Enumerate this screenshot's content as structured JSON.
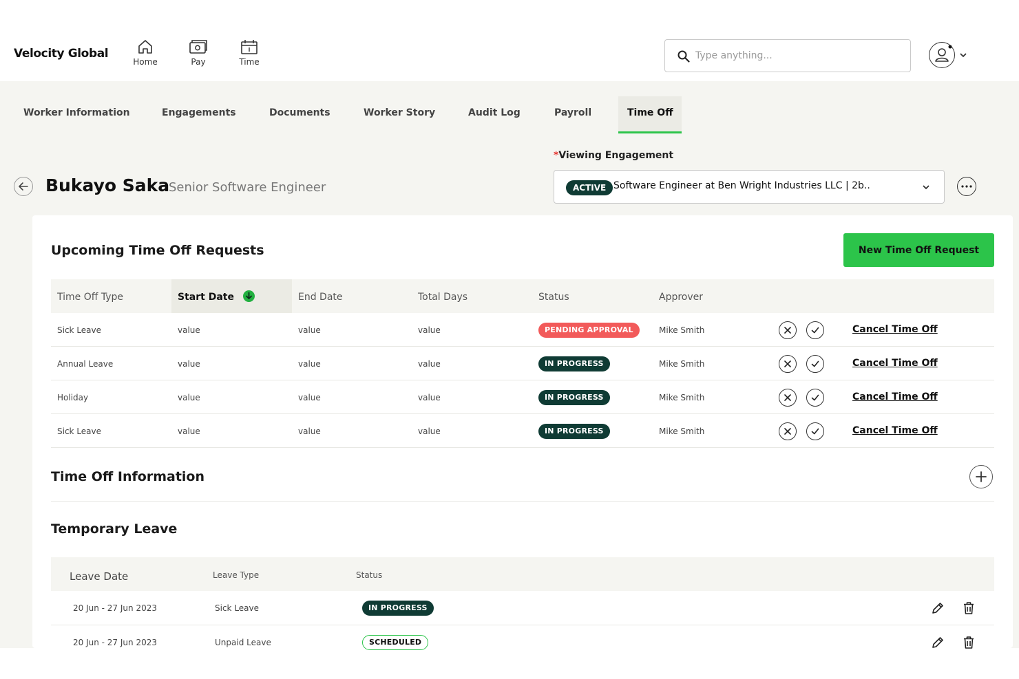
{
  "brand": {
    "name": "Velocity Global"
  },
  "nav": [
    {
      "label": "Home",
      "icon": "home-icon"
    },
    {
      "label": "Pay",
      "icon": "pay-icon"
    },
    {
      "label": "Time",
      "icon": "calendar-icon"
    }
  ],
  "search": {
    "placeholder": "Type anything..."
  },
  "tabs": [
    {
      "label": "Worker Information"
    },
    {
      "label": "Engagements"
    },
    {
      "label": "Documents"
    },
    {
      "label": "Worker Story"
    },
    {
      "label": "Audit Log"
    },
    {
      "label": "Payroll"
    },
    {
      "label": "Time Off",
      "active": true
    }
  ],
  "worker": {
    "name": "Bukayo Saka",
    "title": "Senior Software Engineer"
  },
  "engagement": {
    "label": "Viewing Engagement",
    "required_mark": "*",
    "status": "ACTIVE",
    "value": "Software Engineer at Ben Wright Industries LLC | 2b.."
  },
  "upcoming": {
    "title": "Upcoming Time Off Requests",
    "new_button": "New Time Off Request",
    "columns": [
      "Time Off Type",
      "Start Date",
      "End Date",
      "Total Days",
      "Status",
      "Approver"
    ],
    "sorted_column": "Start Date",
    "rows": [
      {
        "type": "Sick Leave",
        "start": "value",
        "end": "value",
        "days": "value",
        "status": "PENDING APPROVAL",
        "status_kind": "pending",
        "approver": "Mike Smith",
        "action": "Cancel Time Off"
      },
      {
        "type": "Annual Leave",
        "start": "value",
        "end": "value",
        "days": "value",
        "status": "IN PROGRESS",
        "status_kind": "progress",
        "approver": "Mike Smith",
        "action": "Cancel Time Off"
      },
      {
        "type": "Holiday",
        "start": "value",
        "end": "value",
        "days": "value",
        "status": "IN PROGRESS",
        "status_kind": "progress",
        "approver": "Mike Smith",
        "action": "Cancel Time Off"
      },
      {
        "type": "Sick Leave",
        "start": "value",
        "end": "value",
        "days": "value",
        "status": "IN PROGRESS",
        "status_kind": "progress",
        "approver": "Mike Smith",
        "action": "Cancel Time Off"
      }
    ]
  },
  "info": {
    "title": "Time Off Information"
  },
  "temporary": {
    "title": "Temporary Leave",
    "columns": [
      "Leave Date",
      "Leave Type",
      "Status"
    ],
    "rows": [
      {
        "date": "20 Jun - 27 Jun 2023",
        "type": "Sick Leave",
        "status": "IN PROGRESS",
        "status_kind": "progress"
      },
      {
        "date": "20 Jun - 27 Jun 2023",
        "type": "Unpaid Leave",
        "status": "SCHEDULED",
        "status_kind": "scheduled"
      }
    ]
  },
  "colors": {
    "accent": "#2cc44a",
    "dark_badge": "#0f3b34",
    "pending_badge": "#f25a5a",
    "page_bg": "#f5f5f1"
  }
}
